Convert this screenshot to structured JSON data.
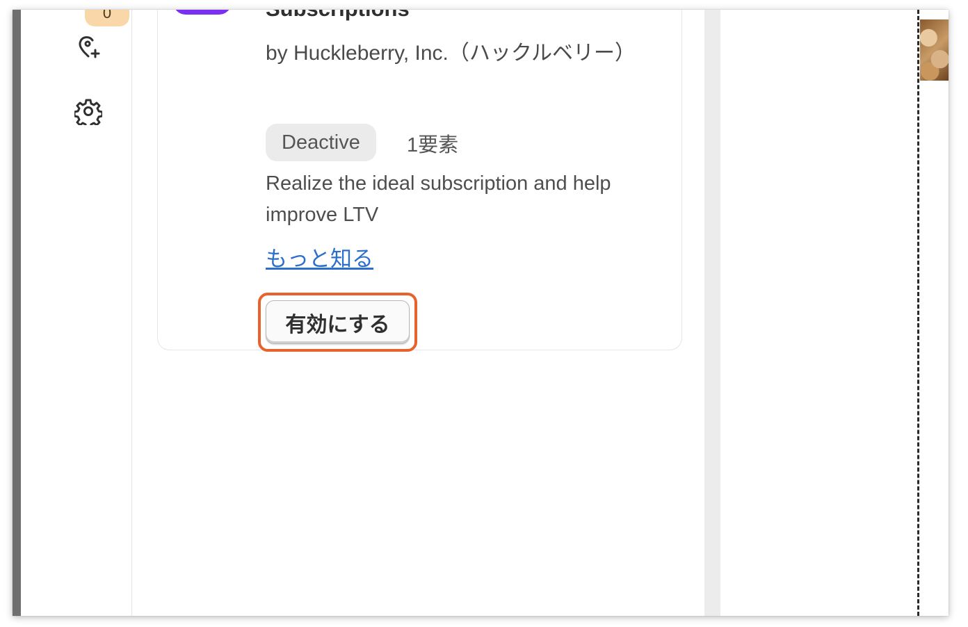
{
  "sidebar": {
    "badge_count": "0",
    "icons": [
      "add-location-icon",
      "gear-icon"
    ]
  },
  "app_card": {
    "title": "Subscriptions",
    "vendor": "by Huckleberry, Inc.（ハックルベリー）",
    "status": "Deactive",
    "element_count": "1要素",
    "description": "Realize the ideal subscription and help improve LTV",
    "learn_more": "もっと知る",
    "activate_button": "有効にする"
  },
  "colors": {
    "highlight": "#e8622c",
    "link": "#2c6ecb",
    "app_logo": "#7b2ff0",
    "badge": "#fad7a8"
  }
}
